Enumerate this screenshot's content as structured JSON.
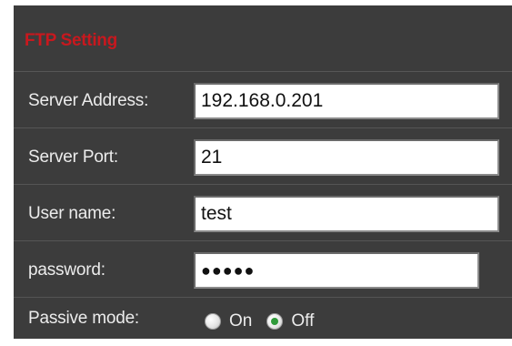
{
  "title": "FTP Setting",
  "colors": {
    "panel_background": "#3c3c3c",
    "title": "#c8181e",
    "label": "#ececec",
    "radio_selected": "#2f9a3a"
  },
  "fields": {
    "server_address": {
      "label": "Server Address:",
      "value": "192.168.0.201"
    },
    "server_port": {
      "label": "Server Port:",
      "value": "21"
    },
    "user_name": {
      "label": "User name:",
      "value": "test"
    },
    "password": {
      "label": "password:",
      "value": "●●●●●"
    }
  },
  "passive_mode": {
    "label": "Passive mode:",
    "options": [
      {
        "label": "On",
        "selected": false
      },
      {
        "label": "Off",
        "selected": true
      }
    ]
  }
}
